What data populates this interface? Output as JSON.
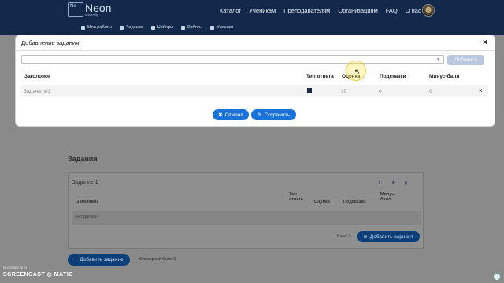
{
  "navbar": {
    "logo_text": "Ne",
    "brand": "Neon",
    "brand_sub": "university",
    "menu": [
      "Каталог",
      "Ученикам",
      "Преподавателям",
      "Организациям",
      "FAQ",
      "О нас"
    ]
  },
  "subnav": {
    "items": [
      "Мои работы",
      "Задания",
      "Наборы",
      "Работы",
      "Ученики"
    ]
  },
  "modal": {
    "title": "Добавление задания",
    "select_value": "",
    "add_label": "Добавить",
    "columns": [
      "Заголовок",
      "Тип ответа",
      "Оценка",
      "Подсказки",
      "Минус-балл"
    ],
    "rows": [
      {
        "title": "Задача №1",
        "score": "10",
        "hints": "0",
        "minus": "0"
      }
    ],
    "cancel_label": "Отмена",
    "save_label": "Сохранить"
  },
  "page": {
    "tasks_title": "Задания",
    "task_name": "Задание 1",
    "inner_columns": [
      "Заголовок",
      "Тип ответа",
      "Оценка",
      "Подсказки",
      "Минус-балл"
    ],
    "no_data": "Нет данных",
    "ball_label": "Балл: 0",
    "add_variant_label": "Добавить вариант",
    "add_task_label": "Добавить задание",
    "sum_label": "Суммарный балл: 0"
  },
  "watermark": {
    "top": "RECORDED WITH",
    "main": "SCREENCAST ◎ MATIC"
  },
  "colors": {
    "navbar": "#13294b",
    "primary": "#1a73d9",
    "add_disabled": "#b9c8de"
  }
}
